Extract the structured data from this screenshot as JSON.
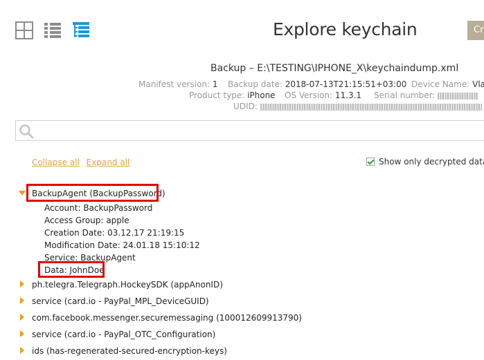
{
  "header": {
    "title": "Explore keychain",
    "action_button": "Cr",
    "views": [
      "grid-view-icon",
      "list-view-icon",
      "tree-view-icon"
    ]
  },
  "backup": {
    "path": "Backup – E:\\TESTING\\IPHONE_X\\keychaindump.xml",
    "manifest_label": "Manifest version:",
    "manifest_value": "1",
    "date_label": "Backup date:",
    "date_value": "2018-07-13T21:15:51+03:00",
    "device_label": "Device Name:",
    "device_value": "Vlad",
    "product_label": "Product type:",
    "product_value": "iPhone",
    "os_label": "OS Version:",
    "os_value": "11.3.1",
    "serial_label": "Serial number:",
    "udid_label": "UDID:"
  },
  "search": {
    "placeholder": ""
  },
  "controls": {
    "collapse_all": "Collapse all",
    "expand_all": "Expand all",
    "show_only_decrypted": "Show only decrypted data",
    "show_only_decrypted_checked": true
  },
  "tree": {
    "expanded_item": {
      "label": "BackupAgent (BackupPassword)",
      "details": [
        {
          "label": "Account:",
          "value": "BackupPassword"
        },
        {
          "label": "Access Group:",
          "value": "apple"
        },
        {
          "label": "Creation Date:",
          "value": "03.12.17 21:19:15"
        },
        {
          "label": "Modification Date:",
          "value": "24.01.18 15:10:12"
        },
        {
          "label": "Service:",
          "value": "BackupAgent"
        },
        {
          "label": "Data:",
          "value": "JohnDoe"
        }
      ]
    },
    "collapsed_items": [
      "ph.telegra.Telegraph.HockeySDK (appAnonID)",
      "service (card.io - PayPal_MPL_DeviceGUID)",
      "com.facebook.messenger.securemessaging (100012609913790)",
      "service (card.io - PayPal_OTC_Configuration)",
      "ids (has-regenerated-secured-encryption-keys)"
    ]
  },
  "colors": {
    "accent": "#f39b1a",
    "link": "#e4a341",
    "active_view": "#1a9ad6",
    "inactive_view": "#8c8c8c",
    "highlight_box": "#e00000"
  }
}
